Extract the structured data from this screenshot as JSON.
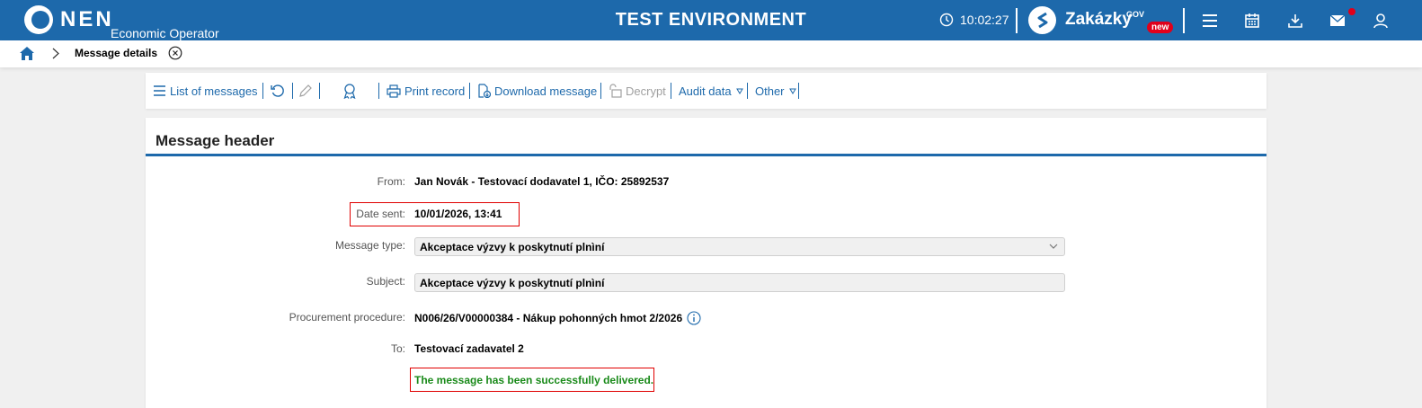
{
  "header": {
    "logo_text": "NEN",
    "logo_subtitle": "Economic Operator",
    "environment": "TEST ENVIRONMENT",
    "clock": "10:02:27",
    "portal_name": "Zakázky",
    "portal_sup": "GOV",
    "portal_badge": "new",
    "icons": [
      "clock-icon",
      "menu-icon",
      "calendar-icon",
      "download-icon",
      "mail-icon",
      "user-icon"
    ],
    "brand_color": "#1d69ab",
    "badge_color": "#e0001b"
  },
  "breadcrumb": {
    "current": "Message details",
    "icons": [
      "home-icon",
      "chevron-right-icon",
      "close-circle-icon"
    ]
  },
  "toolbar": {
    "list": "List of messages",
    "print": "Print record",
    "download": "Download message",
    "decrypt": "Decrypt",
    "audit": "Audit data",
    "other": "Other",
    "icons": [
      "list-icon",
      "refresh-icon",
      "pencil-icon",
      "award-icon",
      "printer-icon",
      "download-doc-icon",
      "lock-icon"
    ]
  },
  "message": {
    "section_title": "Message header",
    "from_label": "From:",
    "from_value": "Jan Novák - Testovací dodavatel 1, IČO: 25892537",
    "date_label": "Date sent:",
    "date_value": "10/01/2026, 13:41",
    "type_label": "Message type:",
    "type_value": "Akceptace výzvy k poskytnutí plnìní",
    "subject_label": "Subject:",
    "subject_value": "Akceptace výzvy k poskytnutí plnìní",
    "procedure_label": "Procurement procedure:",
    "procedure_value": "N006/26/V00000384 - Nákup pohonných hmot 2/2026",
    "to_label": "To:",
    "to_value": "Testovací zadavatel 2",
    "status": "The message has been successfully delivered.",
    "status_color": "#1a8a1a"
  }
}
